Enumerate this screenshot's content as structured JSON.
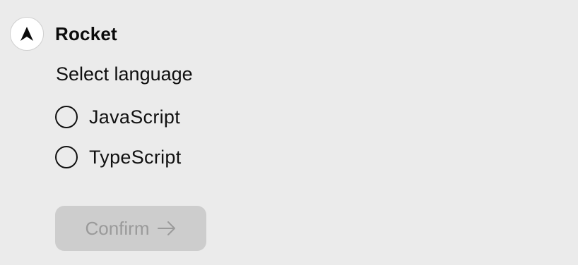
{
  "brand": {
    "name": "Rocket",
    "logo_icon": "rocket-triangle-icon"
  },
  "question": {
    "label": "Select language"
  },
  "options": [
    {
      "label": "JavaScript",
      "selected": false
    },
    {
      "label": "TypeScript",
      "selected": false
    }
  ],
  "confirm_button": {
    "label": "Confirm",
    "icon": "arrow-right-icon",
    "enabled": false
  },
  "colors": {
    "background": "#ebebeb",
    "text": "#111111",
    "button_disabled_bg": "#cdcdcd",
    "button_disabled_text": "#9a9a9a"
  }
}
